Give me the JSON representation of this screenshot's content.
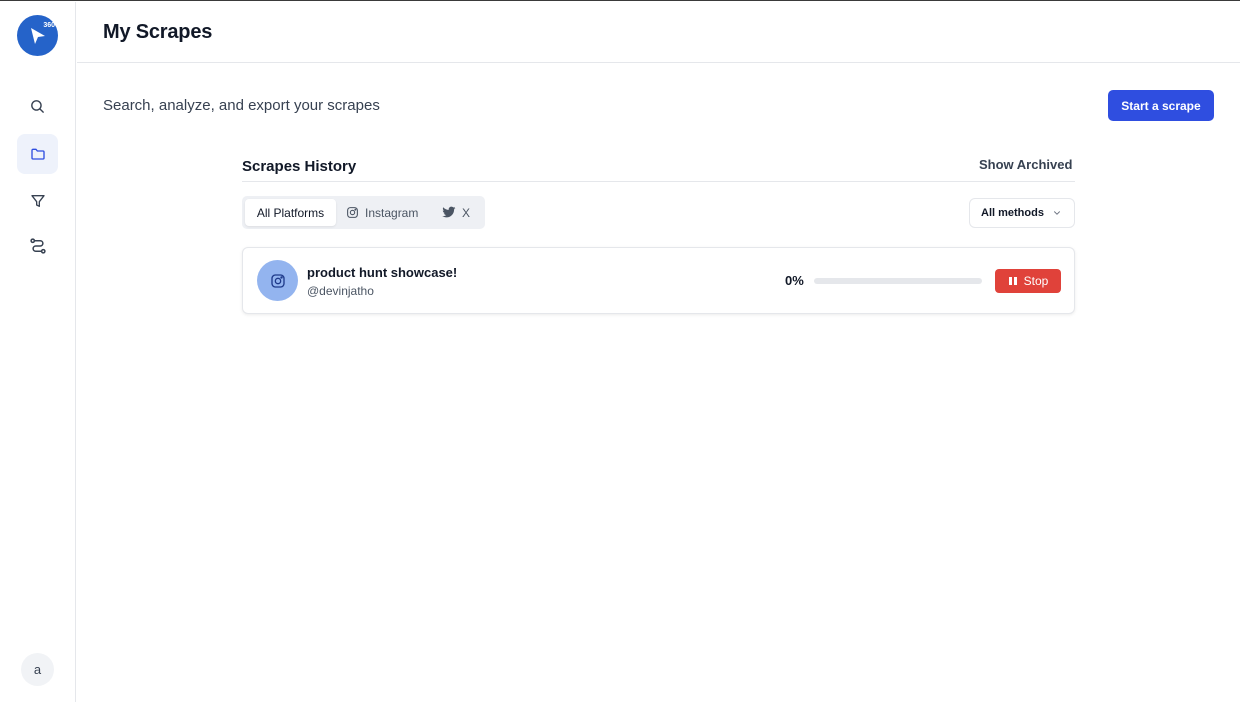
{
  "app": {
    "logo_badge": "360",
    "colors": {
      "primary": "#2f4ee0",
      "logo": "#2563c9",
      "danger": "#e0423a",
      "avatar_bg": "#93b4ef"
    }
  },
  "sidebar": {
    "items": [
      {
        "name": "search",
        "icon": "search-icon",
        "active": false
      },
      {
        "name": "scrapes",
        "icon": "folder-icon",
        "active": true
      },
      {
        "name": "filters",
        "icon": "filter-icon",
        "active": false
      },
      {
        "name": "workflows",
        "icon": "route-icon",
        "active": false
      }
    ],
    "user_initial": "a"
  },
  "header": {
    "title": "My Scrapes"
  },
  "main": {
    "subtitle": "Search, analyze, and export your scrapes",
    "start_button": "Start a scrape",
    "history": {
      "title": "Scrapes History",
      "show_archived": "Show Archived",
      "tabs": [
        {
          "label": "All Platforms",
          "icon": "",
          "active": true
        },
        {
          "label": "Instagram",
          "icon": "instagram-icon",
          "active": false
        },
        {
          "label": "X",
          "icon": "twitter-icon",
          "active": false
        }
      ],
      "methods_select": "All methods",
      "items": [
        {
          "title": "product hunt showcase!",
          "handle": "@devinjatho",
          "platform": "instagram-icon",
          "progress_label": "0%",
          "progress": 0,
          "action": "Stop"
        }
      ]
    }
  }
}
